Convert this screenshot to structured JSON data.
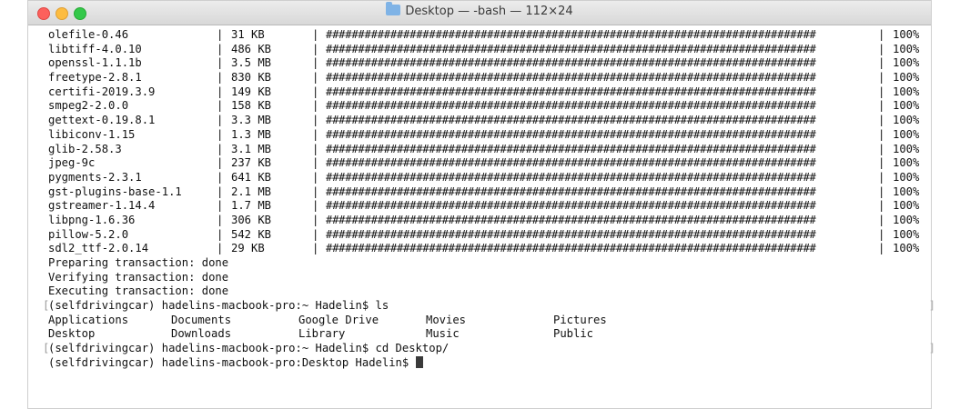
{
  "window": {
    "title": "Desktop — -bash — 112×24",
    "title_icon": "folder-icon"
  },
  "packages": [
    {
      "name": "olefile-0.46",
      "size": "31 KB",
      "bar": "############################################################################",
      "percent": "100%"
    },
    {
      "name": "libtiff-4.0.10",
      "size": "486 KB",
      "bar": "############################################################################",
      "percent": "100%"
    },
    {
      "name": "openssl-1.1.1b",
      "size": "3.5 MB",
      "bar": "############################################################################",
      "percent": "100%"
    },
    {
      "name": "freetype-2.8.1",
      "size": "830 KB",
      "bar": "############################################################################",
      "percent": "100%"
    },
    {
      "name": "certifi-2019.3.9",
      "size": "149 KB",
      "bar": "############################################################################",
      "percent": "100%"
    },
    {
      "name": "smpeg2-2.0.0",
      "size": "158 KB",
      "bar": "############################################################################",
      "percent": "100%"
    },
    {
      "name": "gettext-0.19.8.1",
      "size": "3.3 MB",
      "bar": "############################################################################",
      "percent": "100%"
    },
    {
      "name": "libiconv-1.15",
      "size": "1.3 MB",
      "bar": "############################################################################",
      "percent": "100%"
    },
    {
      "name": "glib-2.58.3",
      "size": "3.1 MB",
      "bar": "############################################################################",
      "percent": "100%"
    },
    {
      "name": "jpeg-9c",
      "size": "237 KB",
      "bar": "############################################################################",
      "percent": "100%"
    },
    {
      "name": "pygments-2.3.1",
      "size": "641 KB",
      "bar": "############################################################################",
      "percent": "100%"
    },
    {
      "name": "gst-plugins-base-1.1",
      "size": "2.1 MB",
      "bar": "############################################################################",
      "percent": "100%"
    },
    {
      "name": "gstreamer-1.14.4",
      "size": "1.7 MB",
      "bar": "############################################################################",
      "percent": "100%"
    },
    {
      "name": "libpng-1.6.36",
      "size": "306 KB",
      "bar": "############################################################################",
      "percent": "100%"
    },
    {
      "name": "pillow-5.2.0",
      "size": "542 KB",
      "bar": "############################################################################",
      "percent": "100%"
    },
    {
      "name": "sdl2_ttf-2.0.14",
      "size": "29 KB",
      "bar": "############################################################################",
      "percent": "100%"
    }
  ],
  "status_lines": [
    "Preparing transaction: done",
    "Verifying transaction: done",
    "Executing transaction: done"
  ],
  "prompt1": "(selfdrivingcar) hadelins-macbook-pro:~ Hadelin$ ls",
  "ls_output": [
    [
      "Applications",
      "Documents",
      "Google Drive",
      "Movies",
      "Pictures"
    ],
    [
      "Desktop",
      "Downloads",
      "Library",
      "Music",
      "Public"
    ]
  ],
  "prompt2": "(selfdrivingcar) hadelins-macbook-pro:~ Hadelin$ cd Desktop/",
  "prompt3": "(selfdrivingcar) hadelins-macbook-pro:Desktop Hadelin$ ",
  "bracket_prefix": "[",
  "scroll_mark": "]",
  "separator": "|"
}
